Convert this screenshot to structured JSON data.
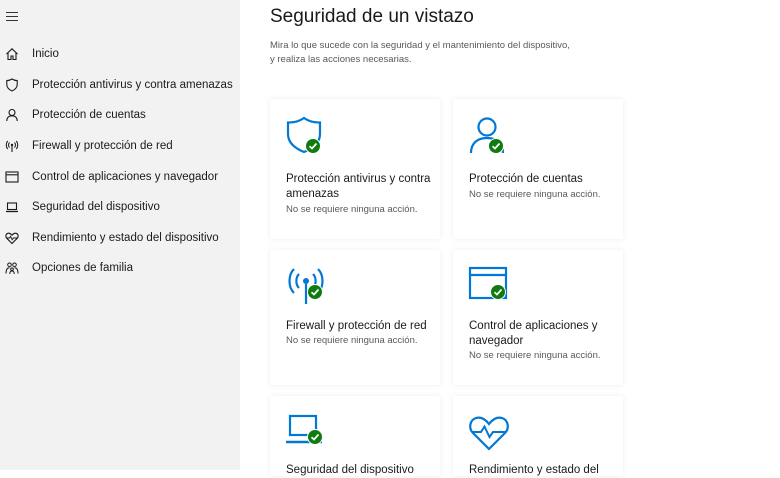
{
  "colors": {
    "accent": "#0078d4",
    "ok": "#107c10",
    "sidebar_bg": "#f2f2f2"
  },
  "sidebar": {
    "items": [
      {
        "icon": "home-icon",
        "label": "Inicio"
      },
      {
        "icon": "shield-icon",
        "label": "Protección antivirus y contra amenazas"
      },
      {
        "icon": "person-icon",
        "label": "Protección de cuentas"
      },
      {
        "icon": "wireless-icon",
        "label": "Firewall y protección de red"
      },
      {
        "icon": "browser-icon",
        "label": "Control de aplicaciones y navegador"
      },
      {
        "icon": "laptop-icon",
        "label": "Seguridad del dispositivo"
      },
      {
        "icon": "heart-icon",
        "label": "Rendimiento y estado del dispositivo"
      },
      {
        "icon": "family-icon",
        "label": "Opciones de familia"
      }
    ]
  },
  "main": {
    "title": "Seguridad de un vistazo",
    "description": "Mira lo que sucede con la seguridad y el mantenimiento del dispositivo, y realiza las acciones necesarias.",
    "cards": [
      {
        "icon": "shield-icon",
        "title": "Protección antivirus y contra amenazas",
        "status": "No se requiere ninguna acción."
      },
      {
        "icon": "person-icon",
        "title": "Protección de cuentas",
        "status": "No se requiere ninguna acción."
      },
      {
        "icon": "wireless-icon",
        "title": "Firewall y protección de red",
        "status": "No se requiere ninguna acción."
      },
      {
        "icon": "browser-icon",
        "title": "Control de aplicaciones y navegador",
        "status": "No se requiere ninguna acción."
      },
      {
        "icon": "laptop-icon",
        "title": "Seguridad del dispositivo",
        "status": ""
      },
      {
        "icon": "heart-icon",
        "title": "Rendimiento y estado del",
        "status": ""
      }
    ]
  }
}
